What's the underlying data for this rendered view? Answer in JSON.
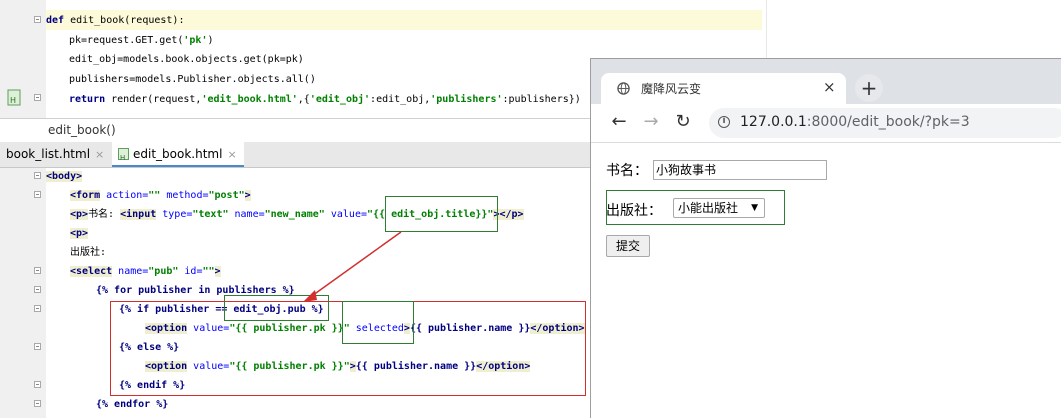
{
  "ide": {
    "python_lines": {
      "l1_def": "def",
      "l1_rest": " edit_book(request):",
      "l2": "pk=request.GET.get(",
      "l2_str": "'pk'",
      "l2_end": ")",
      "l3": "edit_obj=models.book.objects.get(pk=pk)",
      "l4": "publishers=models.Publisher.objects.all()",
      "l5_kw": "return",
      "l5_a": " render(request,",
      "l5_s1": "'edit_book.html'",
      "l5_b": ",{",
      "l5_s2": "'edit_obj'",
      "l5_c": ":edit_obj,",
      "l5_s3": "'publishers'",
      "l5_d": ":publishers})"
    },
    "breadcrumb": "edit_book()",
    "tabs": [
      {
        "label": "book_list.html",
        "close": "×"
      },
      {
        "label": "edit_book.html",
        "close": "×"
      }
    ],
    "html_lines": {
      "body_tag": "<body>",
      "form_tag": "<form",
      "form_action_attr": " action=",
      "form_action_val": "\"\"",
      "form_method_attr": " method=",
      "form_method_val": "\"post\"",
      "form_close": ">",
      "p_open": "<p>",
      "p_text": "书名:",
      "input_tag": "<input",
      "input_type_attr": " type=",
      "input_type_val": "\"text\"",
      "input_name_attr": " name=",
      "input_name_val": "\"new_name\"",
      "input_value_attr": " value=",
      "input_value_val": "\"{{ edit_obj.title}}\"",
      "input_close": "></p>",
      "p_only": "<p>",
      "pub_text": "出版社:",
      "select_tag": "<select",
      "select_name_attr": " name=",
      "select_name_val": "\"pub\"",
      "select_id_attr": " id=",
      "select_id_val": "\"\"",
      "select_close": ">",
      "for_tpl": "{% for publisher in publishers %}",
      "if_tpl": "{% if publisher == edit_obj.pub %}",
      "opt1_tag": "<option",
      "opt1_attr": " value=",
      "opt1_val": "\"{{ publisher.pk }}\"",
      "opt1_selected": " selected",
      "opt1_mid": ">",
      "opt1_text": "{{ publisher.name }}",
      "opt1_close": "</option>",
      "else_tpl": "{% else %}",
      "opt2_tag": "<option",
      "opt2_attr": " value=",
      "opt2_val": "\"{{ publisher.pk }}\"",
      "opt2_mid": ">",
      "opt2_text": "{{ publisher.name }}",
      "opt2_close": "</option>",
      "endif_tpl": "{% endif %}",
      "endfor_tpl": "{% endfor %}"
    }
  },
  "browser": {
    "tab_title": "魔降风云变",
    "tab_close": "×",
    "new_tab": "+",
    "back": "←",
    "forward": "→",
    "reload": "↻",
    "info_icon": "i",
    "url_host": "127.0.0.1",
    "url_path": ":8000/edit_book/?pk=3",
    "book_label": "书名：",
    "book_value": "小狗故事书",
    "pub_label": "出版社：",
    "pub_selected": "小能出版社",
    "submit_label": "提交"
  },
  "colors": {
    "annotation_green": "#2e7d32",
    "annotation_red": "#d32f2f"
  }
}
